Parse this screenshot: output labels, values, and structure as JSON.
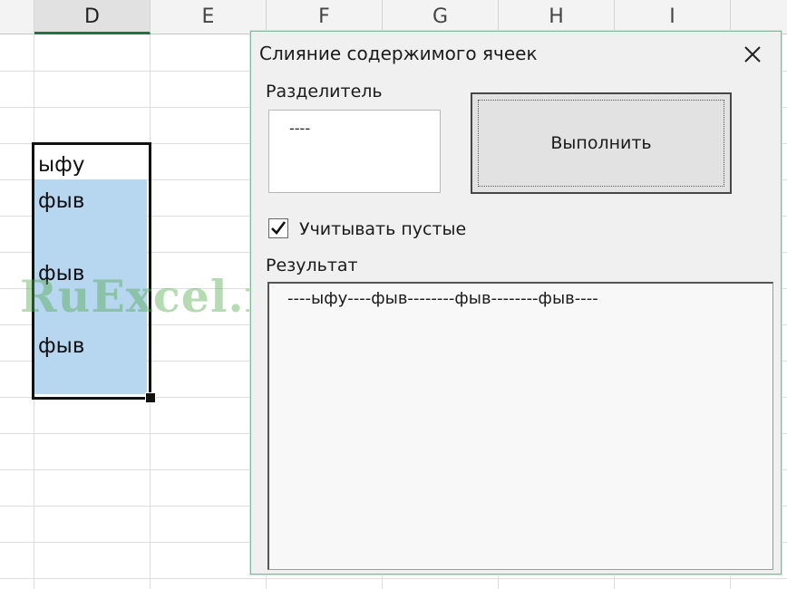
{
  "spreadsheet": {
    "columns": [
      "D",
      "E",
      "F",
      "G",
      "H",
      "I"
    ],
    "selected_column": "D",
    "cells": [
      {
        "value": "ыфу"
      },
      {
        "value": "фыв"
      },
      {
        "value": "фыв"
      },
      {
        "value": "фыв"
      }
    ],
    "watermark": "RuExcel.ru",
    "selection_color": "#b7d6f0"
  },
  "dialog": {
    "title": "Слияние содержимого ячеек",
    "close_icon": "close-icon",
    "separator": {
      "label": "Разделитель",
      "value": "----"
    },
    "execute_button": {
      "label": "Выполнить"
    },
    "ignore_empty": {
      "label": "Учитывать пустые",
      "checked": true
    },
    "result": {
      "label": "Результат",
      "value": "----ыфу----фыв--------фыв--------фыв----"
    },
    "accent_color": "#86b7a2"
  }
}
